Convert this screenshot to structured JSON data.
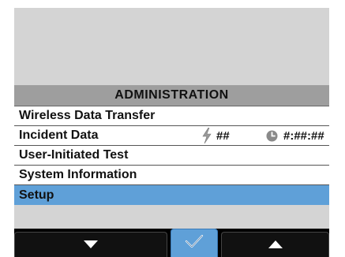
{
  "menu": {
    "title": "ADMINISTRATION",
    "items": [
      {
        "label": "Wireless Data Transfer"
      },
      {
        "label": "Incident Data",
        "count": "##",
        "time": "#:##:##"
      },
      {
        "label": "User-Initiated Test"
      },
      {
        "label": "System Information"
      },
      {
        "label": "Setup",
        "selected": true
      }
    ]
  },
  "icons": {
    "incident_count": "lightning-bolt-icon",
    "incident_time": "clock-icon",
    "softkey_left": "arrow-down-icon",
    "softkey_center": "checkmark-icon",
    "softkey_right": "arrow-up-icon"
  },
  "colors": {
    "screen_background": "#d4d4d4",
    "header_background": "#9e9e9e",
    "selected_highlight": "#5fa0d8",
    "softkey_bar": "#000000"
  }
}
